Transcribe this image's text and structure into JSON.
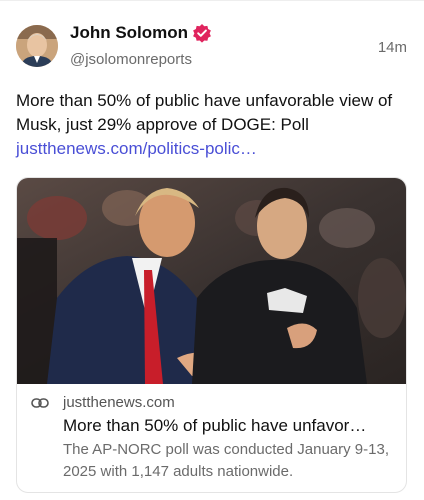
{
  "author": {
    "name": "John Solomon",
    "handle": "@jsolomonreports",
    "verified_icon": "verified-badge-icon",
    "verified_color": "#e0245e"
  },
  "post": {
    "timestamp": "14m",
    "text": "More than 50% of public have unfavorable view of Musk, just 29% approve of DOGE: Poll",
    "link_text": "justthenews.com/politics-polic…"
  },
  "link_card": {
    "image_icon": "photo-two-men-in-crowd",
    "link_icon": "chain-link-icon",
    "domain": "justthenews.com",
    "title": "More than 50% of public have unfavor…",
    "description": "The AP-NORC poll was conducted January 9-13, 2025 with 1,147 adults nationwide."
  },
  "colors": {
    "link": "#4a4fd6",
    "secondary_text": "#6b6b6b",
    "border": "#e4e4e4"
  }
}
